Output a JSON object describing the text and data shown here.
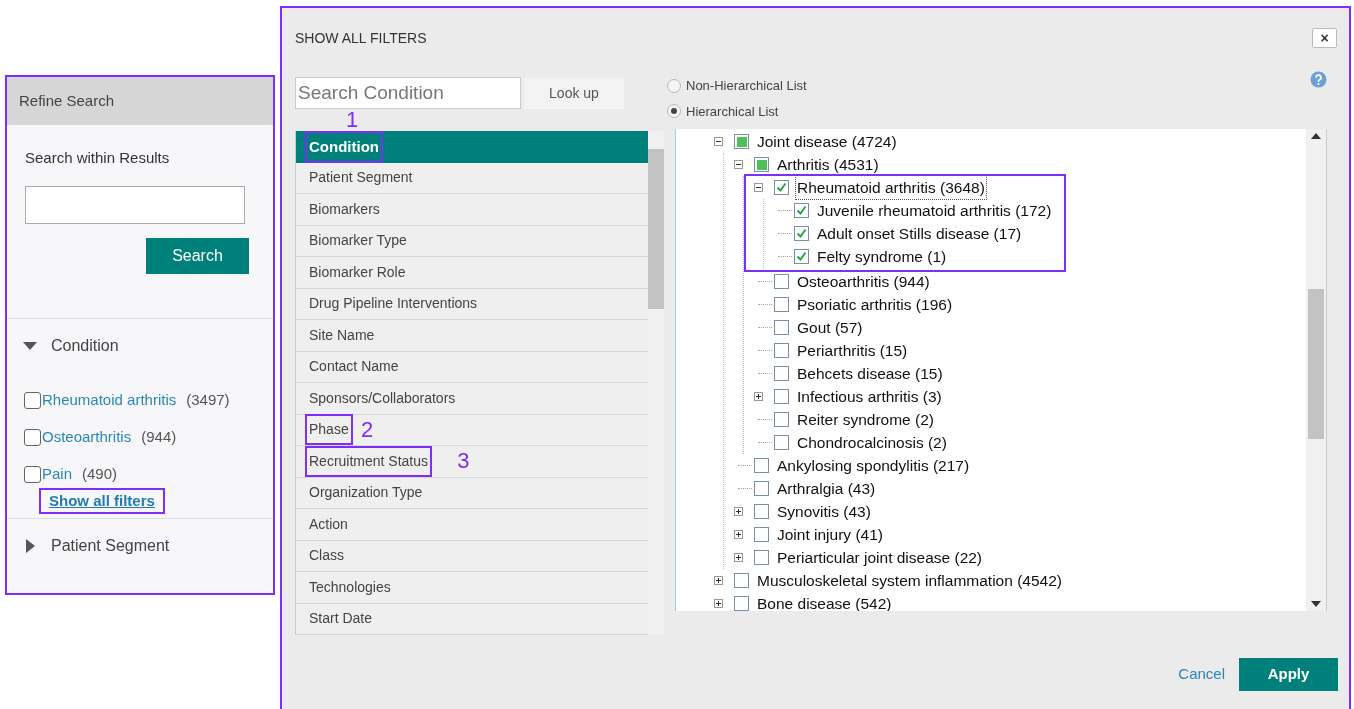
{
  "refine": {
    "title": "Refine Search",
    "search_label": "Search within Results",
    "search_button": "Search",
    "outlined": true,
    "sections": [
      {
        "title": "Condition",
        "expanded": true,
        "items": [
          {
            "label": "Rheumatoid arthritis",
            "count": "(3497)",
            "checked": false
          },
          {
            "label": "Osteoarthritis",
            "count": "(944)",
            "checked": false
          },
          {
            "label": "Pain",
            "count": "(490)",
            "checked": false
          }
        ],
        "link": {
          "label": "Show all filters",
          "outlined": true
        }
      },
      {
        "title": "Patient Segment",
        "expanded": false
      }
    ]
  },
  "modal": {
    "title": "SHOW ALL FILTERS",
    "close": "×",
    "outlined": true,
    "search": {
      "placeholder": "Search Condition"
    },
    "lookup": "Look up",
    "filters": [
      {
        "label": "Condition",
        "selected": true,
        "outlined": true,
        "callout": "1"
      },
      {
        "label": "Patient Segment",
        "selected": false
      },
      {
        "label": "Biomarkers",
        "selected": false
      },
      {
        "label": "Biomarker Type",
        "selected": false
      },
      {
        "label": "Biomarker Role",
        "selected": false
      },
      {
        "label": "Drug Pipeline Interventions",
        "selected": false
      },
      {
        "label": "Site Name",
        "selected": false
      },
      {
        "label": "Contact Name",
        "selected": false
      },
      {
        "label": "Sponsors/Collaborators",
        "selected": false
      },
      {
        "label": "Phase",
        "selected": false,
        "outlined": true,
        "callout": "2"
      },
      {
        "label": "Recruitment Status",
        "selected": false,
        "outlined": true,
        "callout": "3"
      },
      {
        "label": "Organization Type",
        "selected": false
      },
      {
        "label": "Action",
        "selected": false
      },
      {
        "label": "Class",
        "selected": false
      },
      {
        "label": "Technologies",
        "selected": false
      },
      {
        "label": "Start Date",
        "selected": false
      }
    ],
    "views": [
      {
        "label": "Non-Hierarchical List",
        "selected": false
      },
      {
        "label": "Hierarchical List",
        "selected": true
      }
    ],
    "tree": [
      {
        "label": "Joint disease (4724)",
        "checked": false,
        "partial": true,
        "expanded": true,
        "children": [
          {
            "label": "Arthritis (4531)",
            "checked": false,
            "partial": true,
            "expanded": true,
            "children": [
              {
                "label": "Rheumatoid arthritis (3648)",
                "checked": true,
                "expanded": true,
                "outlined": true,
                "focused": true,
                "children": [
                  {
                    "label": "Juvenile rheumatoid arthritis (172)",
                    "checked": true
                  },
                  {
                    "label": "Adult onset Stills disease (17)",
                    "checked": true
                  },
                  {
                    "label": "Felty syndrome (1)",
                    "checked": true
                  }
                ]
              },
              {
                "label": "Osteoarthritis (944)",
                "checked": false
              },
              {
                "label": "Psoriatic arthritis (196)",
                "checked": false
              },
              {
                "label": "Gout (57)",
                "checked": false
              },
              {
                "label": "Periarthritis (15)",
                "checked": false
              },
              {
                "label": "Behcets disease (15)",
                "checked": false
              },
              {
                "label": "Infectious arthritis (3)",
                "checked": false,
                "expanded": false
              },
              {
                "label": "Reiter syndrome (2)",
                "checked": false
              },
              {
                "label": "Chondrocalcinosis (2)",
                "checked": false
              }
            ]
          },
          {
            "label": "Ankylosing spondylitis (217)",
            "checked": false
          },
          {
            "label": "Arthralgia (43)",
            "checked": false
          },
          {
            "label": "Synovitis (43)",
            "checked": false,
            "expanded": false
          },
          {
            "label": "Joint injury (41)",
            "checked": false,
            "expanded": false
          },
          {
            "label": "Periarticular joint disease (22)",
            "checked": false,
            "expanded": false
          }
        ]
      },
      {
        "label": "Musculoskeletal system inflammation (4542)",
        "checked": false,
        "expanded": false
      },
      {
        "label": "Bone disease (542)",
        "checked": false,
        "expanded": false
      }
    ],
    "cancel": "Cancel",
    "apply": "Apply"
  }
}
